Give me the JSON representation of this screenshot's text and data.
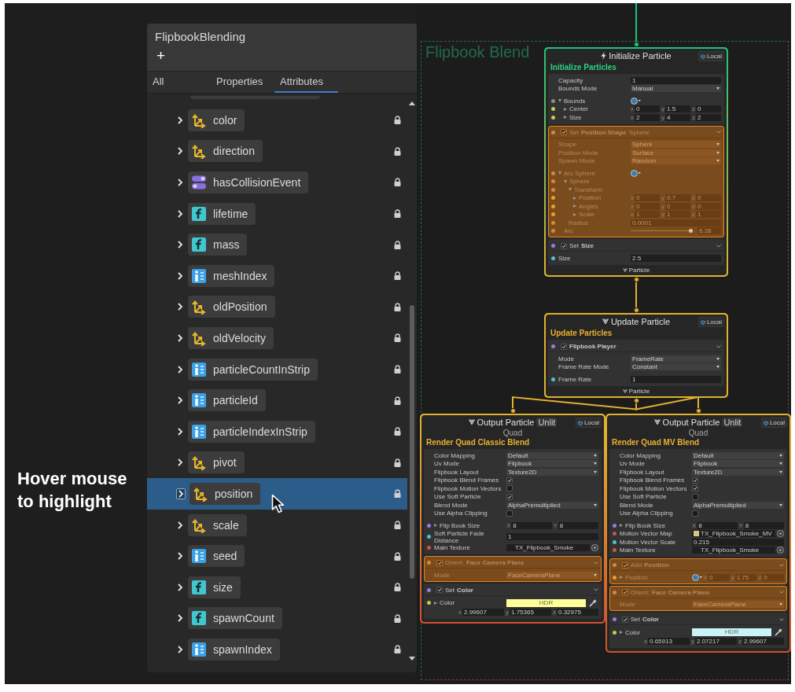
{
  "annotation": "Hover mouse to highlight",
  "panel": {
    "title": "FlipbookBlending",
    "add_label": "+",
    "tabs": [
      {
        "label": "All",
        "selected": false
      },
      {
        "label": "Properties",
        "selected": false
      },
      {
        "label": "Attributes",
        "selected": true
      }
    ],
    "attributes": [
      {
        "name": "color",
        "kind": "vector",
        "selected": false
      },
      {
        "name": "direction",
        "kind": "vector",
        "selected": false
      },
      {
        "name": "hasCollisionEvent",
        "kind": "bool",
        "selected": false
      },
      {
        "name": "lifetime",
        "kind": "float",
        "selected": false
      },
      {
        "name": "mass",
        "kind": "float",
        "selected": false
      },
      {
        "name": "meshIndex",
        "kind": "uint",
        "selected": false
      },
      {
        "name": "oldPosition",
        "kind": "vector",
        "selected": false
      },
      {
        "name": "oldVelocity",
        "kind": "vector",
        "selected": false
      },
      {
        "name": "particleCountInStrip",
        "kind": "uint",
        "selected": false
      },
      {
        "name": "particleId",
        "kind": "uint",
        "selected": false
      },
      {
        "name": "particleIndexInStrip",
        "kind": "uint",
        "selected": false
      },
      {
        "name": "pivot",
        "kind": "vector",
        "selected": false
      },
      {
        "name": "position",
        "kind": "vector",
        "selected": true
      },
      {
        "name": "scale",
        "kind": "vector",
        "selected": false
      },
      {
        "name": "seed",
        "kind": "uint",
        "selected": false
      },
      {
        "name": "size",
        "kind": "float",
        "selected": false
      },
      {
        "name": "spawnCount",
        "kind": "float",
        "selected": false
      },
      {
        "name": "spawnIndex",
        "kind": "uint",
        "selected": false
      }
    ]
  },
  "graph": {
    "group_title": "Flipbook Blend",
    "nodes": [
      {
        "kind": "initialize",
        "title": "Initialize Particle",
        "space": "Local",
        "heading": "Initialize Particles",
        "footer": "Particle",
        "blocks": [
          {
            "highlighted": false,
            "rows": [
              {
                "label": "Capacity",
                "kind": "text",
                "value": "1"
              },
              {
                "label": "Bounds Mode",
                "kind": "dropdown",
                "value": "Manual"
              },
              {
                "label": "Bounds",
                "kind": "group",
                "color": "#8c8c8c",
                "expanded": true,
                "gizmo": true,
                "children": [
                  {
                    "label": "Center",
                    "kind": "vector",
                    "color": "#c8c850",
                    "expanded": false,
                    "components": [
                      {
                        "axis": "x",
                        "value": "0"
                      },
                      {
                        "axis": "y",
                        "value": "1.5"
                      },
                      {
                        "axis": "z",
                        "value": "0"
                      }
                    ]
                  },
                  {
                    "label": "Size",
                    "kind": "vector",
                    "color": "#c8c850",
                    "expanded": false,
                    "components": [
                      {
                        "axis": "x",
                        "value": "2"
                      },
                      {
                        "axis": "y",
                        "value": "4"
                      },
                      {
                        "axis": "z",
                        "value": "2"
                      }
                    ]
                  }
                ]
              }
            ]
          },
          {
            "highlighted": true,
            "header": {
              "checked": true,
              "verb": "Set",
              "name": "Position Shape",
              "detail": "Sphere",
              "color": "#d08a40"
            },
            "rows": [
              {
                "label": "Shape",
                "kind": "dropdown",
                "value": "Sphere"
              },
              {
                "label": "Position Mode",
                "kind": "dropdown",
                "value": "Surface"
              },
              {
                "label": "Spawn Mode",
                "kind": "dropdown",
                "value": "Random"
              },
              {
                "label": "Arc Sphere",
                "kind": "group",
                "color": "#d08a40",
                "expanded": true,
                "gizmo": true,
                "children": [
                  {
                    "label": "Sphere",
                    "kind": "group",
                    "color": "#d08a40",
                    "expanded": true,
                    "children": [
                      {
                        "label": "Transform",
                        "kind": "group",
                        "color": "#d08a40",
                        "expanded": true,
                        "children": [
                          {
                            "label": "Position",
                            "kind": "vector",
                            "color": "#e8a030",
                            "expanded": false,
                            "components": [
                              {
                                "axis": "x",
                                "value": "0"
                              },
                              {
                                "axis": "y",
                                "value": "0.7"
                              },
                              {
                                "axis": "z",
                                "value": "0"
                              }
                            ]
                          },
                          {
                            "label": "Angles",
                            "kind": "vector",
                            "color": "#e8a030",
                            "expanded": false,
                            "components": [
                              {
                                "axis": "x",
                                "value": "0"
                              },
                              {
                                "axis": "y",
                                "value": "0"
                              },
                              {
                                "axis": "z",
                                "value": "0"
                              }
                            ]
                          },
                          {
                            "label": "Scale",
                            "kind": "vector",
                            "color": "#e8a030",
                            "expanded": false,
                            "components": [
                              {
                                "axis": "x",
                                "value": "1"
                              },
                              {
                                "axis": "y",
                                "value": "1"
                              },
                              {
                                "axis": "z",
                                "value": "1"
                              }
                            ]
                          }
                        ]
                      },
                      {
                        "label": "Radius",
                        "kind": "text",
                        "color": "#d08a40",
                        "value": "0.0001"
                      }
                    ]
                  },
                  {
                    "label": "Arc",
                    "kind": "slider",
                    "color": "#d08a40",
                    "level": 1,
                    "value": "6.28"
                  }
                ]
              }
            ]
          },
          {
            "highlighted": false,
            "header": {
              "checked": true,
              "verb": "Set",
              "name": "Size",
              "color": "#9b7be0"
            },
            "rows": [
              {
                "label": "Size",
                "kind": "text",
                "color": "#4fc3d0",
                "value": "2.5"
              }
            ]
          }
        ]
      },
      {
        "kind": "update",
        "title": "Update Particle",
        "space": "Local",
        "heading": "Update Particles",
        "footer": "Particle",
        "blocks": [
          {
            "highlighted": false,
            "header": {
              "checked": true,
              "name": "Flipbook Player",
              "color": "#9b7be0"
            },
            "rows": [
              {
                "label": "Mode",
                "kind": "dropdown",
                "value": "FrameRate"
              },
              {
                "label": "Frame Rate Mode",
                "kind": "dropdown",
                "value": "Constant"
              },
              {
                "label": "Frame Rate",
                "kind": "text",
                "color": "#4fc3d0",
                "value": "1"
              }
            ]
          }
        ]
      },
      {
        "kind": "output",
        "title": "Output Particle",
        "tag": "Unlit",
        "subtitle": "Quad",
        "space": "Local",
        "heading": "Render Quad Classic Blend",
        "blocks": [
          {
            "highlighted": false,
            "rows": [
              {
                "label": "Color Mapping",
                "kind": "dropdown",
                "value": "Default"
              },
              {
                "label": "Uv Mode",
                "kind": "dropdown",
                "value": "Flipbook"
              },
              {
                "label": "Flipbook Layout",
                "kind": "dropdown",
                "value": "Texture2D"
              },
              {
                "label": "Flipbook Blend Frames",
                "kind": "check",
                "checked": true
              },
              {
                "label": "Flipbook Motion Vectors",
                "kind": "check",
                "checked": false
              },
              {
                "label": "Use Soft Particle",
                "kind": "check",
                "checked": true
              },
              {
                "label": "Blend Mode",
                "kind": "dropdown",
                "value": "AlphaPremultiplied"
              },
              {
                "label": "Use Alpha Clipping",
                "kind": "check",
                "checked": false
              },
              {
                "label": "Flip Book Size",
                "kind": "vector",
                "color": "#9b7be0",
                "expanded": false,
                "components": [
                  {
                    "axis": "X",
                    "value": "8"
                  },
                  {
                    "axis": "Y",
                    "value": "8"
                  }
                ]
              },
              {
                "label": "Soft Particle Fade Distance",
                "kind": "text",
                "color": "#4fc3d0",
                "value": "1"
              },
              {
                "label": "Main Texture",
                "kind": "texture",
                "color": "#d05050",
                "value": "TX_Flipbook_Smoke"
              }
            ]
          },
          {
            "highlighted": true,
            "header": {
              "checked": true,
              "verb": "Orient:",
              "name": "Face Camera Plane",
              "color": "#d08a40"
            },
            "rows": [
              {
                "label": "Mode",
                "kind": "dropdown",
                "value": "FaceCameraPlane"
              }
            ]
          },
          {
            "highlighted": false,
            "header": {
              "checked": true,
              "verb": "Set",
              "name": "Color",
              "color": "#9b7be0"
            },
            "rows": [
              {
                "label": "Color",
                "kind": "color",
                "color": "#c8c850",
                "expanded": false,
                "swatch": {
                  "color": "#ffff99",
                  "label": "HDR"
                },
                "components": [
                  {
                    "axis": "x",
                    "value": "2.99607"
                  },
                  {
                    "axis": "y",
                    "value": "1.75365"
                  },
                  {
                    "axis": "z",
                    "value": "0.32975"
                  }
                ]
              }
            ]
          }
        ]
      },
      {
        "kind": "output",
        "title": "Output Particle",
        "tag": "Unlit",
        "subtitle": "Quad",
        "space": "Local",
        "heading": "Render Quad MV Blend",
        "blocks": [
          {
            "highlighted": false,
            "rows": [
              {
                "label": "Color Mapping",
                "kind": "dropdown",
                "value": "Default"
              },
              {
                "label": "Uv Mode",
                "kind": "dropdown",
                "value": "Flipbook"
              },
              {
                "label": "Flipbook Layout",
                "kind": "dropdown",
                "value": "Texture2D"
              },
              {
                "label": "Flipbook Blend Frames",
                "kind": "check",
                "checked": true
              },
              {
                "label": "Flipbook Motion Vectors",
                "kind": "check",
                "checked": true
              },
              {
                "label": "Use Soft Particle",
                "kind": "check",
                "checked": false
              },
              {
                "label": "Blend Mode",
                "kind": "dropdown",
                "value": "AlphaPremultiplied"
              },
              {
                "label": "Use Alpha Clipping",
                "kind": "check",
                "checked": false
              },
              {
                "label": "Flip Book Size",
                "kind": "vector",
                "color": "#9b7be0",
                "expanded": false,
                "components": [
                  {
                    "axis": "X",
                    "value": "8"
                  },
                  {
                    "axis": "Y",
                    "value": "8"
                  }
                ]
              },
              {
                "label": "Motion Vector Map",
                "kind": "texture",
                "color": "#d05050",
                "thumbnail": {
                  "color": "#d8c888"
                },
                "value": "TX_Flipbook_Smoke_MV"
              },
              {
                "label": "Motion Vector Scale",
                "kind": "text",
                "color": "#4fc3d0",
                "value": "0.215"
              },
              {
                "label": "Main Texture",
                "kind": "texture",
                "color": "#d05050",
                "value": "TX_Flipbook_Smoke"
              }
            ]
          },
          {
            "highlighted": true,
            "header": {
              "checked": true,
              "verb": "Add",
              "name": "Position",
              "color": "#d08a40"
            },
            "rows": [
              {
                "label": "Position",
                "kind": "vector",
                "color": "#e8a030",
                "expanded": false,
                "gizmo": true,
                "components": [
                  {
                    "axis": "x",
                    "value": "0"
                  },
                  {
                    "axis": "y",
                    "value": "1.75"
                  },
                  {
                    "axis": "z",
                    "value": "0"
                  }
                ]
              }
            ]
          },
          {
            "highlighted": true,
            "header": {
              "checked": true,
              "verb": "Orient:",
              "name": "Face Camera Plane",
              "color": "#d08a40"
            },
            "rows": [
              {
                "label": "Mode",
                "kind": "dropdown",
                "value": "FaceCameraPlane"
              }
            ]
          },
          {
            "highlighted": false,
            "header": {
              "checked": true,
              "verb": "Set",
              "name": "Color",
              "color": "#9b7be0"
            },
            "rows": [
              {
                "label": "Color",
                "kind": "color",
                "color": "#c8c850",
                "expanded": false,
                "swatch": {
                  "color": "#c8f4f8",
                  "label": "HDR"
                },
                "components": [
                  {
                    "axis": "x",
                    "value": "0.65913"
                  },
                  {
                    "axis": "y",
                    "value": "2.07217"
                  },
                  {
                    "axis": "z",
                    "value": "2.99607"
                  }
                ]
              }
            ]
          }
        ]
      }
    ]
  }
}
